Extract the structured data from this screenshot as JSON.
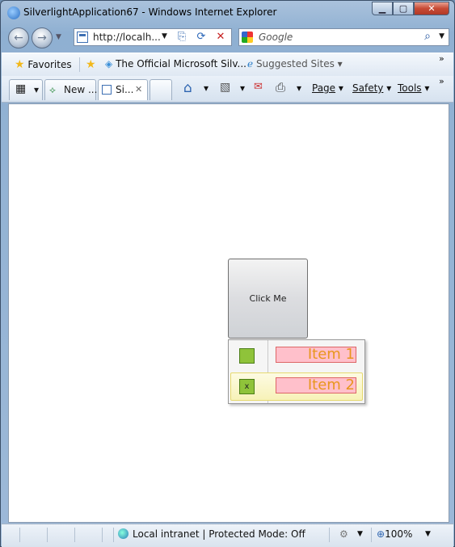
{
  "window": {
    "title": "SilverlightApplication67 - Windows Internet Explorer",
    "minimize": "▁",
    "maximize": "▢",
    "close": "✕"
  },
  "nav": {
    "back_icon": "←",
    "forward_icon": "→",
    "dropdown": "▼"
  },
  "address": {
    "url": "http://localh...",
    "dropdown": "▼",
    "compat_icon": "⎘",
    "refresh_icon": "⟳",
    "stop_icon": "✕"
  },
  "search": {
    "placeholder": "Google",
    "icon": "⌕",
    "dropdown": "▼"
  },
  "favorites_bar": {
    "favorites_label": "Favorites",
    "link1": "The Official Microsoft Silv...",
    "link2": "Suggested Sites ▾",
    "chevron": "»"
  },
  "tabs": {
    "quick_tabs": "▦",
    "quick_tabs_dd": "▾",
    "tab1": "New ...",
    "tab2": "Si...",
    "tab_close": "✕",
    "chevron": "»"
  },
  "commands": {
    "home": "⌂",
    "dd": "▾",
    "feeds": "▧",
    "mail": "✉",
    "print": "⎙",
    "page": "Page",
    "safety": "Safety",
    "tools": "Tools"
  },
  "app": {
    "button_label": "Click Me",
    "menu_items": [
      {
        "label": "Item 1",
        "check": ""
      },
      {
        "label": "Item 2",
        "check": "x"
      }
    ]
  },
  "status": {
    "zone": "Local intranet | Protected Mode: Off",
    "zoom": "100%",
    "dd": "▼"
  }
}
